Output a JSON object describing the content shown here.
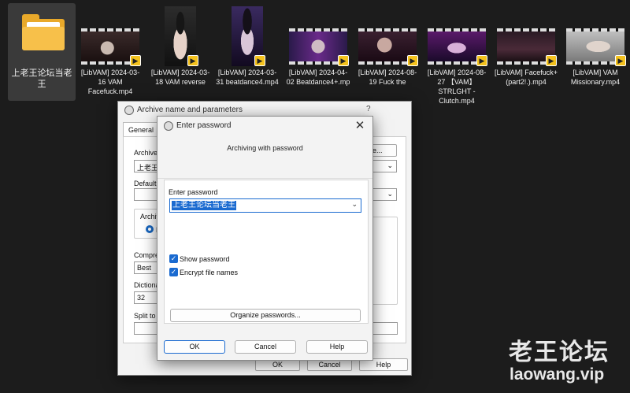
{
  "desktop": {
    "files": [
      {
        "label": "上老王论坛当老王",
        "type": "folder",
        "icon": "folder-icon"
      },
      {
        "label": "[LibVAM] 2024-03-16 VAM Facefuck.mp4",
        "type": "video",
        "icon": "video-thumbnail"
      },
      {
        "label": "[LibVAM] 2024-03-18 VAM reverse",
        "type": "video",
        "icon": "video-thumbnail"
      },
      {
        "label": "[LibVAM] 2024-03-31 beatdance4.mp4",
        "type": "video",
        "icon": "video-thumbnail"
      },
      {
        "label": "[LibVAM] 2024-04-02 Beatdance4+.mp",
        "type": "video",
        "icon": "video-thumbnail"
      },
      {
        "label": "[LibVAM] 2024-08-19 Fuck the",
        "type": "video",
        "icon": "video-thumbnail"
      },
      {
        "label": "[LibVAM] 2024-08-27 【VAM】STRLGHT - Clutch.mp4",
        "type": "video",
        "icon": "video-thumbnail"
      },
      {
        "label": "[LibVAM] Facefuck+ (part2!.).mp4",
        "type": "video",
        "icon": "video-thumbnail"
      },
      {
        "label": "[LibVAM] VAM Missionary.mp4",
        "type": "video",
        "icon": "video-thumbnail"
      }
    ],
    "player_badge": "Player"
  },
  "archive_dialog": {
    "title": "Archive name and parameters",
    "help": "?",
    "tab_general": "General",
    "archive_label": "Archive",
    "archive_value": "上老王",
    "browse_label": "se...",
    "default_label": "Default",
    "archive_format_label": "Archiv",
    "radio_label": "R",
    "compression_label": "Compre",
    "compression_value": "Best",
    "dictionary_label": "Dictiona",
    "dictionary_value": "32",
    "split_label": "Split to",
    "ok": "OK",
    "cancel": "Cancel",
    "help_button": "Help"
  },
  "password_dialog": {
    "title": "Enter password",
    "subtitle": "Archiving with password",
    "enter_password_label": "Enter password",
    "password_value": "上老王论坛当老王",
    "show_password": {
      "label": "Show password",
      "checked": true
    },
    "encrypt_file_names": {
      "label": "Encrypt file names",
      "checked": true
    },
    "organize_passwords": "Organize passwords...",
    "ok": "OK",
    "cancel": "Cancel",
    "help": "Help"
  },
  "watermark": {
    "name": "老王论坛",
    "url": "laowang.vip"
  },
  "colors": {
    "desktop_bg": "#1c1c1c",
    "accent": "#1a6ad0",
    "folder": "#f7c04a",
    "badge": "#f4c21d"
  }
}
